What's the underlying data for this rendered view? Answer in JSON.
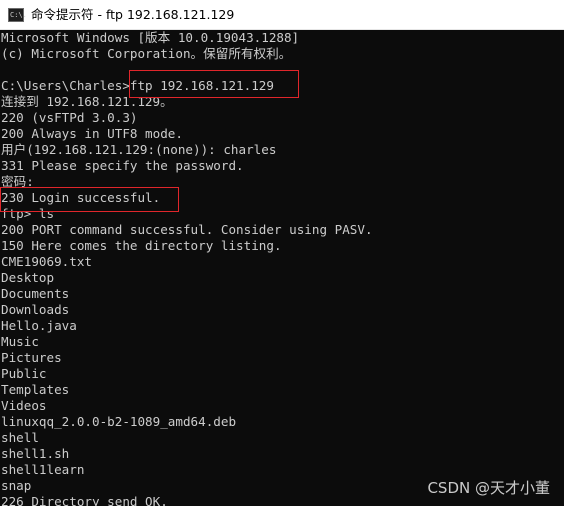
{
  "window": {
    "title": "命令提示符 - ftp  192.168.121.129",
    "icon": "console-icon",
    "icon_text": "C:\\."
  },
  "terminal": {
    "lines": [
      "Microsoft Windows [版本 10.0.19043.1288]",
      "(c) Microsoft Corporation。保留所有权利。",
      "",
      "C:\\Users\\Charles>ftp 192.168.121.129",
      "连接到 192.168.121.129。",
      "220 (vsFTPd 3.0.3)",
      "200 Always in UTF8 mode.",
      "用户(192.168.121.129:(none)): charles",
      "331 Please specify the password.",
      "密码:",
      "230 Login successful.",
      "ftp> ls",
      "200 PORT command successful. Consider using PASV.",
      "150 Here comes the directory listing.",
      "CME19069.txt",
      "Desktop",
      "Documents",
      "Downloads",
      "Hello.java",
      "Music",
      "Pictures",
      "Public",
      "Templates",
      "Videos",
      "linuxqq_2.0.0-b2-1089_amd64.deb",
      "shell",
      "shell1.sh",
      "shell1learn",
      "snap",
      "226 Directory send OK."
    ]
  },
  "highlight_color": "#e0262b",
  "watermark": "CSDN @天才小董"
}
